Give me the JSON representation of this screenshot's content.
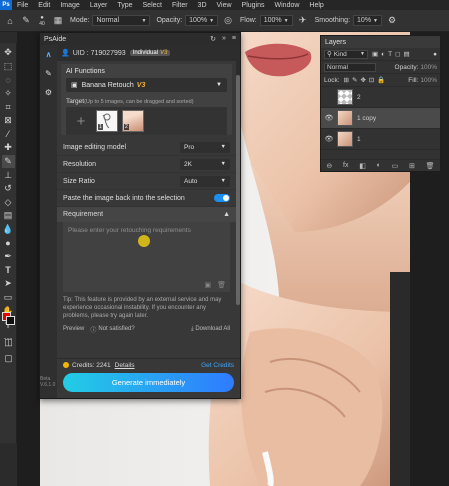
{
  "menubar": {
    "logo": "Ps",
    "items": [
      "File",
      "Edit",
      "Image",
      "Layer",
      "Type",
      "Select",
      "Filter",
      "3D",
      "View",
      "Plugins",
      "Window",
      "Help"
    ]
  },
  "options": {
    "brush_size": "40",
    "mode_label": "Mode:",
    "mode_value": "Normal",
    "opacity_label": "Opacity:",
    "opacity_value": "100%",
    "flow_label": "Flow:",
    "flow_value": "100%",
    "smoothing_label": "Smoothing:",
    "smoothing_value": "10%"
  },
  "layers_panel": {
    "title": "Layers",
    "kind_label": "Kind",
    "blend_mode": "Normal",
    "opacity_label": "Opacity:",
    "opacity_value": "100%",
    "lock_label": "Lock:",
    "fill_label": "Fill:",
    "fill_value": "100%",
    "layers": [
      {
        "name": "2",
        "visible": false
      },
      {
        "name": "1 copy",
        "visible": true
      },
      {
        "name": "1",
        "visible": true
      }
    ],
    "footer_icons": [
      "link-icon",
      "fx-icon",
      "mask-icon",
      "adjustment-icon",
      "folder-icon",
      "new-layer-icon",
      "trash-icon"
    ],
    "footer_text": {
      "link": "⊖",
      "fx": "fx"
    }
  },
  "psaide": {
    "title": "PsAide",
    "uid_label": "UID : 719027993",
    "plan_label": "Individual",
    "plan_version": "V3",
    "ai_functions_label": "AI Functions",
    "function_name": "Banana Retouch",
    "function_version": "V3",
    "target_label": "Target",
    "target_hint": "(Up to 5 images, can be dragged and sorted)",
    "thumbs": [
      {
        "num": "1"
      },
      {
        "num": "2"
      }
    ],
    "image_model_label": "Image editing model",
    "image_model_value": "Pro",
    "resolution_label": "Resolution",
    "resolution_value": "2K",
    "size_ratio_label": "Size Ratio",
    "size_ratio_value": "Auto",
    "paste_back_label": "Paste the image back into the selection",
    "paste_back_enabled": true,
    "requirement_label": "Requirement",
    "requirement_placeholder": "Please enter your retouching requirements",
    "tip_text": "Tip: This feature is provided by an external service and may experience occasional instability. If you encounter any problems, please try again later.",
    "preview_label": "Preview",
    "not_satisfied_label": "Not satisfied?",
    "download_all_label": "Download All",
    "credits_label": "Credits: 2241",
    "details_label": "Details",
    "get_credits_label": "Get Credits",
    "generate_label": "Generate immediately",
    "beta_label": "Beta",
    "version_label": "V.6.1.0"
  },
  "colors": {
    "accent": "#1d8ff3",
    "version_badge": "#f3b23a",
    "foreground_swatch": "#e60000",
    "background_swatch": "#111111"
  }
}
